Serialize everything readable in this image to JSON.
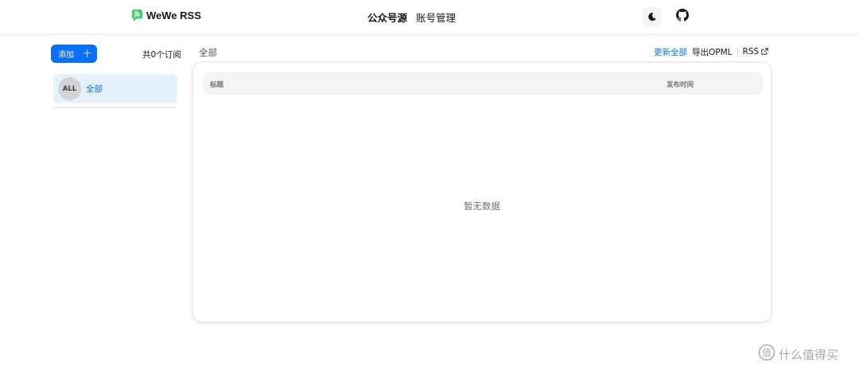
{
  "header": {
    "brand_name": "WeWe RSS",
    "nav": [
      {
        "label": "公众号源",
        "active": true
      },
      {
        "label": "账号管理",
        "active": false
      }
    ],
    "theme_icon": "moon-icon",
    "github_icon": "github-icon"
  },
  "sidebar": {
    "add_label": "添加",
    "add_icon": "plus-icon",
    "count_text": "共0个订阅",
    "items": [
      {
        "avatar": "ALL",
        "label": "全部",
        "selected": true
      }
    ]
  },
  "main": {
    "title": "全部",
    "actions": {
      "update_all": "更新全部",
      "export_opml": "导出OPML",
      "rss": "RSS"
    },
    "table": {
      "columns": [
        "标题",
        "发布时间"
      ],
      "rows": [],
      "empty_text": "暂无数据"
    }
  },
  "watermark": {
    "text": "什么值得买"
  },
  "colors": {
    "primary": "#0a6ff0",
    "selected_bg": "#e6f1fe",
    "brand_green": "#22c55e"
  }
}
